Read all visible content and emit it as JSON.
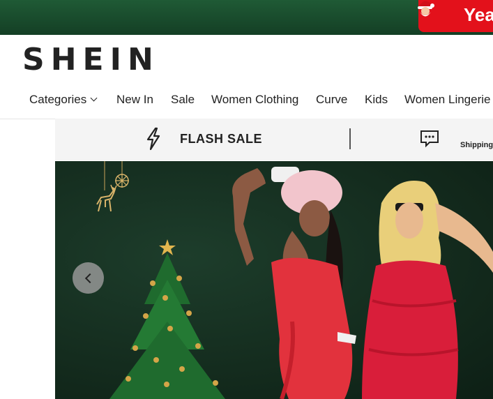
{
  "promo": {
    "text": "Yea",
    "santa_icon": "santa-icon"
  },
  "brand": {
    "logo_text": "SHEIN"
  },
  "nav": {
    "items": [
      "Categories",
      "New In",
      "Sale",
      "Women Clothing",
      "Curve",
      "Kids",
      "Women Lingerie"
    ]
  },
  "flash_bar": {
    "flash_label": "FLASH SALE",
    "shipping_label": "Shipping",
    "flash_icon": "lightning-icon",
    "chat_icon": "chat-bubble-icon"
  },
  "hero": {
    "prev_icon": "chevron-left-icon"
  },
  "colors": {
    "topbar": "#1c4f30",
    "promo": "#e3111b",
    "hero_bg": "#13291c",
    "dress": "#e2323d"
  }
}
